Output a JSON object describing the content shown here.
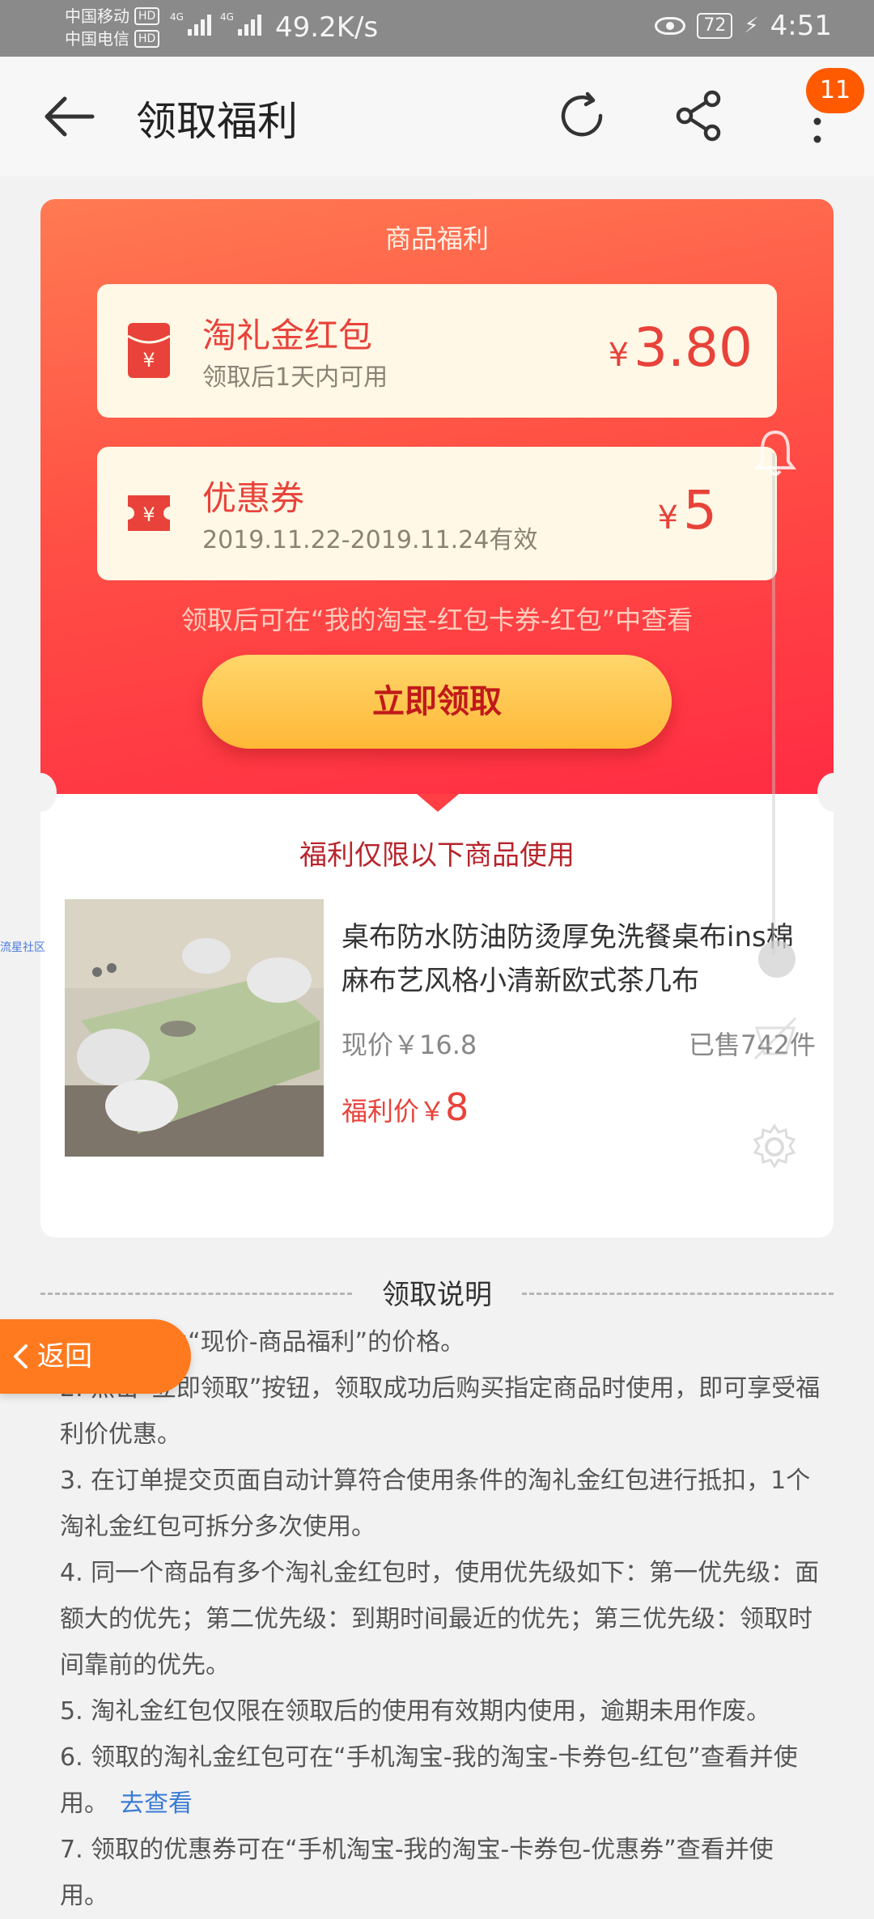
{
  "status_bar": {
    "carrier1": "中国移动",
    "carrier2": "中国电信",
    "hd": "HD",
    "net": "4G",
    "speed": "49.2K/s",
    "battery": "72",
    "time": "4:51"
  },
  "nav": {
    "title": "领取福利",
    "badge_count": "11"
  },
  "card": {
    "header": "商品福利",
    "coupons": [
      {
        "title": "淘礼金红包",
        "subtitle": "领取后1天内可用",
        "currency": "¥",
        "amount": "3.80",
        "icon": "red-envelope-icon"
      },
      {
        "title": "优惠券",
        "subtitle": "2019.11.22-2019.11.24有效",
        "currency": "¥",
        "amount": "5",
        "icon": "ticket-icon"
      }
    ],
    "notice": "领取后可在“我的淘宝-红包卡券-红包”中查看",
    "claim_button": "立即领取"
  },
  "product_section": {
    "limit_text": "福利仅限以下商品使用",
    "title": "桌布防水防油防烫厚免洗餐桌布ins棉麻布艺风格小清新欧式茶几布",
    "price": "现价￥16.8",
    "sold": "已售742件",
    "welfare_label": "福利价￥",
    "welfare_price": "8"
  },
  "overlay": {
    "side_label": "流星社区"
  },
  "instructions": {
    "heading": "领取说明",
    "items": [
      "1. 福利价为“现价-商品福利”的价格。",
      "2. 点击“立即领取”按钮，领取成功后购买指定商品时使用，即可享受福利价优惠。",
      "3. 在订单提交页面自动计算符合使用条件的淘礼金红包进行抵扣，1个淘礼金红包可拆分多次使用。",
      "4. 同一个商品有多个淘礼金红包时，使用优先级如下：第一优先级：面额大的优先；第二优先级：到期时间最近的优先；第三优先级：领取时间靠前的优先。",
      "5. 淘礼金红包仅限在领取后的使用有效期内使用，逾期未用作废。",
      "6. 领取的淘礼金红包可在“手机淘宝-我的淘宝-卡券包-红包”查看并使用。",
      "7. 领取的优惠券可在“手机淘宝-我的淘宝-卡券包-优惠券”查看并使用。"
    ],
    "link_text": "去查看"
  },
  "back_float": {
    "label": "返回"
  },
  "colors": {
    "accent_red": "#e8423a",
    "button_gold": "#ffc54d",
    "back_orange": "#ff7a1f",
    "link_blue": "#3a7bd5"
  }
}
